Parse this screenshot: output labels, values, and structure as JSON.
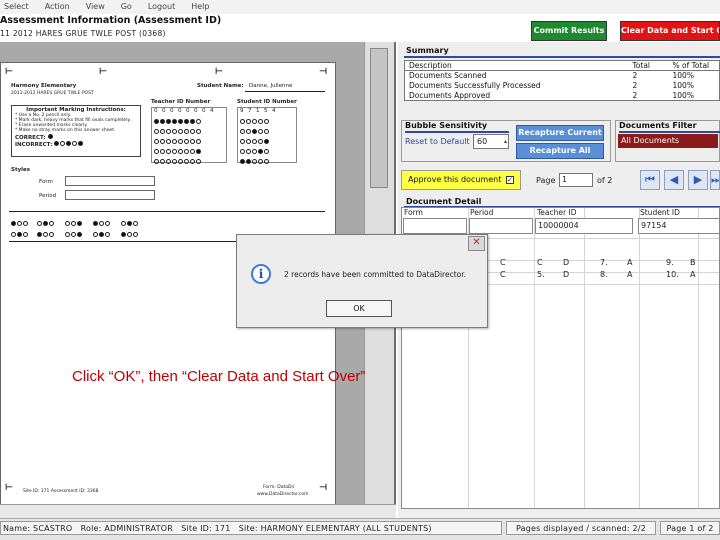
{
  "menu": [
    "Select",
    "Action",
    "View",
    "Go",
    "Logout",
    "Help"
  ],
  "header": {
    "title": "Assessment Information (Assessment ID)",
    "subtitle": "11 2012 HARES GRUE TWLE POST  (0368)"
  },
  "toolbar": {
    "commit_label": "Commit Results",
    "clear_label": "Clear Data and Start Over"
  },
  "scan_sheet": {
    "school": "Harmony Elementary",
    "test_name": "2011-2012 HARES GRUE TWLE POST",
    "student_name_label": "Student Name:",
    "student_name": "Danne, Julienne",
    "teacher_id_label": "Teacher ID Number",
    "student_id_label": "Student ID Number",
    "instructions_title": "Important Marking Instructions:",
    "instructions": [
      "* Use a No. 2 pencil only.",
      "* Mark dark, heavy marks that fill ovals completely.",
      "* Erase unwanted marks clearly.",
      "* Make no stray marks on this answer sheet."
    ],
    "correct_label": "CORRECT:",
    "incorrect_label": "INCORRECT:",
    "styles_label": "Styles",
    "form_label": "Form",
    "period_label": "Period",
    "teacher_digits": [
      "0",
      "0",
      "0",
      "0",
      "0",
      "0",
      "0",
      "4"
    ],
    "student_digits": [
      "9",
      "7",
      "1",
      "5",
      "4"
    ],
    "footer_left": "Site ID: 171   Assessment ID: 3368",
    "footer_right_1": "Form: DataDir",
    "footer_right_2": "www.DataDirector.com"
  },
  "summary": {
    "title": "Summary",
    "columns": [
      "Description",
      "Total",
      "% of Total"
    ],
    "rows": [
      [
        "Documents Scanned",
        "2",
        "100%"
      ],
      [
        "Documents Successfully Processed",
        "2",
        "100%"
      ],
      [
        "Documents Approved",
        "2",
        "100%"
      ]
    ]
  },
  "bubble_sensitivity": {
    "title": "Bubble Sensitivity",
    "reset_label": "Reset to Default",
    "value": "60",
    "recapture_current": "Recapture Current",
    "recapture_all": "Recapture All"
  },
  "documents_filter": {
    "title": "Documents Filter",
    "selected": "All Documents"
  },
  "approve": {
    "label": "Approve this document",
    "checked": true
  },
  "pager": {
    "page_label": "Page",
    "page_value": "1",
    "of_label": "of",
    "total": "2"
  },
  "document_detail": {
    "title": "Document Detail",
    "columns": [
      "Form",
      "Period",
      "Teacher ID",
      "Student ID"
    ],
    "row": [
      "",
      "",
      "10000004",
      "97154"
    ],
    "answers_row1": [
      "C",
      "C",
      "D",
      "7.",
      "A",
      "9.",
      "B"
    ],
    "answers_row2": [
      "C",
      "5.",
      "D",
      "8.",
      "A",
      "10.",
      "A"
    ]
  },
  "dialog": {
    "message": "2 records have been committed to DataDirector.",
    "ok_label": "OK",
    "close_symbol": "✕",
    "info_symbol": "i"
  },
  "caption": "Click “OK”, then “Clear Data and Start Over”",
  "status": {
    "user": "Name: SCASTRO",
    "role": "Role: ADMINISTRATOR",
    "site_id": "Site ID: 171",
    "site": "Site: HARMONY ELEMENTARY (ALL STUDENTS)",
    "pages": "Pages displayed / scanned: 2/2",
    "page_of": "Page 1 of 2"
  },
  "colors": {
    "commit": "#1e8a2f",
    "clear": "#e01414",
    "approve_bg": "#ffff44",
    "filter_bg": "#8b1a1a",
    "caption": "#c00000"
  }
}
